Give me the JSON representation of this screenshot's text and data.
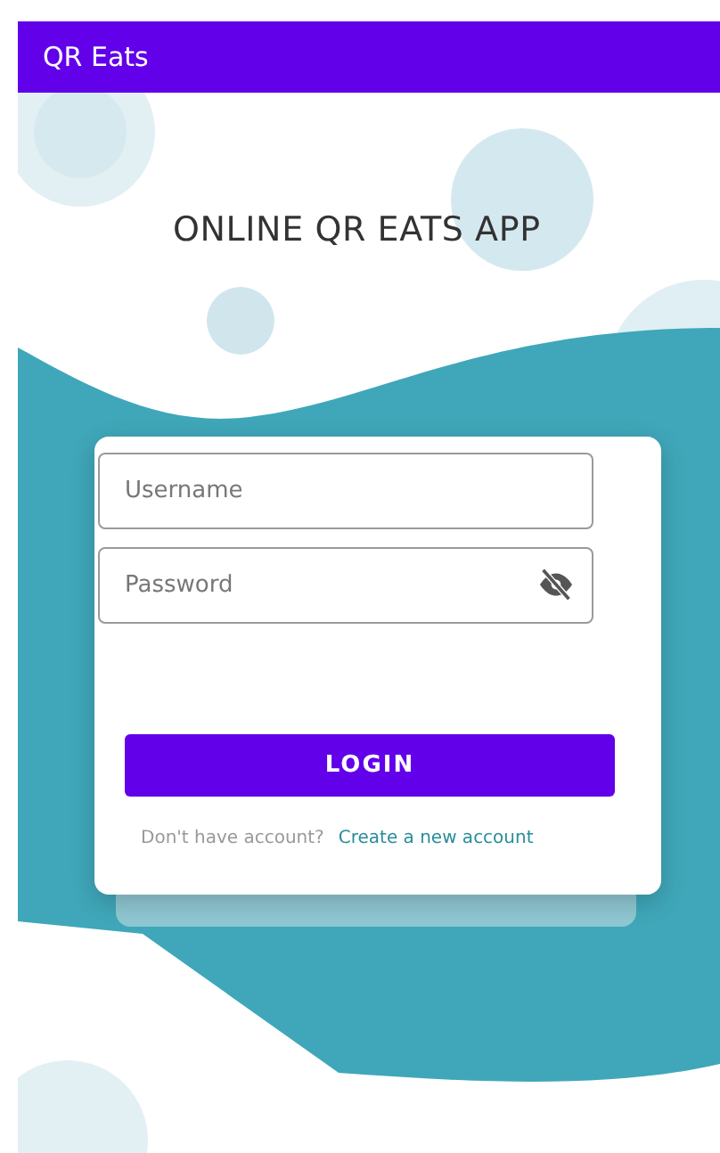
{
  "app_bar": {
    "title": "QR Eats"
  },
  "heading": "ONLINE QR EATS APP",
  "form": {
    "fields": [
      {
        "kind": "text",
        "placeholder": "Username"
      },
      {
        "kind": "password",
        "placeholder": "Password"
      }
    ],
    "submit": "LOGIN",
    "footer": {
      "prompt": "Don't have account?",
      "link": "Create a new account"
    }
  }
}
